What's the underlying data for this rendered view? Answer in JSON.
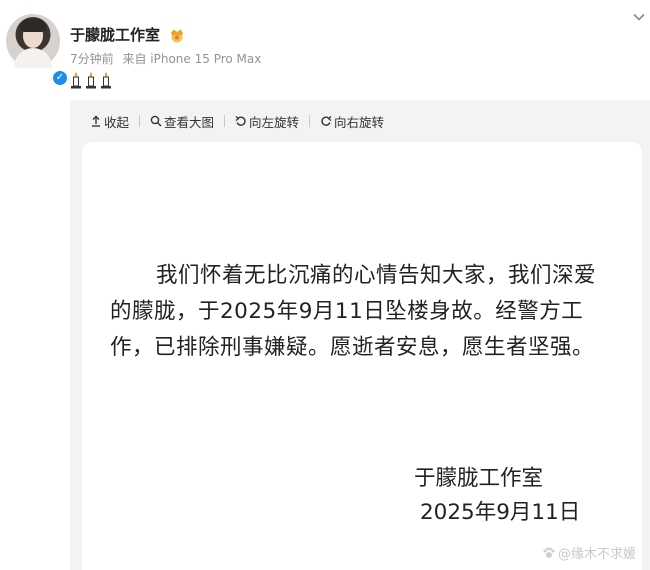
{
  "post": {
    "author": "于朦胧工作室",
    "time": "7分钟前",
    "source": "来自 iPhone 15 Pro Max",
    "verified_mark": "✓",
    "icons": {
      "crown": "crown-emoji-icon",
      "candles": [
        "candle-icon",
        "candle-icon",
        "candle-icon"
      ],
      "expand": "chevron-down-icon"
    }
  },
  "toolbar": {
    "collapse_label": "收起",
    "view_large_label": "查看大图",
    "rotate_left_label": "向左旋转",
    "rotate_right_label": "向右旋转"
  },
  "image": {
    "body": "我们怀着无比沉痛的心情告知大家，我们深爱的朦胧，于2025年9月11日坠楼身故。经警方工作，已排除刑事嫌疑。愿逝者安息，愿生者坚强。",
    "signature_name": "于朦胧工作室",
    "signature_date": "2025年9月11日",
    "watermark": "@缘木不求媛"
  },
  "colors": {
    "accent_verified": "#1e8eea",
    "meta_text": "#939393",
    "viewer_bg": "#f3f3f3"
  }
}
